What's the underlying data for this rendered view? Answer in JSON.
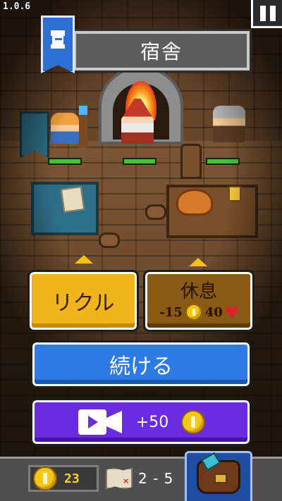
{
  "hud": {
    "version": "1.0.6",
    "pause_label": "pause"
  },
  "location": {
    "title": "宿舎",
    "banner_icon": "hero-portrait-icon"
  },
  "actions": {
    "recruit_label": "リクル",
    "rest_label": "休息",
    "rest_cost": "-15",
    "rest_heal": "40",
    "continue_label": "続ける",
    "ad_reward": "+50",
    "ad_icon": "video-camera-icon"
  },
  "party": [
    {
      "role": "knight",
      "hp_fraction": 1.0
    },
    {
      "role": "wizard",
      "hp_fraction": 1.0
    },
    {
      "role": "warrior",
      "hp_fraction": 1.0
    }
  ],
  "footer": {
    "gold": "23",
    "stage": "2 - 5",
    "inventory_icon": "backpack-icon"
  },
  "colors": {
    "recruit": "#f2b41c",
    "rest": "#8a5a12",
    "continue": "#2e7be6",
    "ad": "#6b2be0",
    "coin": "#f4c51a",
    "heart": "#d8232a",
    "hp": "#46c23a"
  }
}
